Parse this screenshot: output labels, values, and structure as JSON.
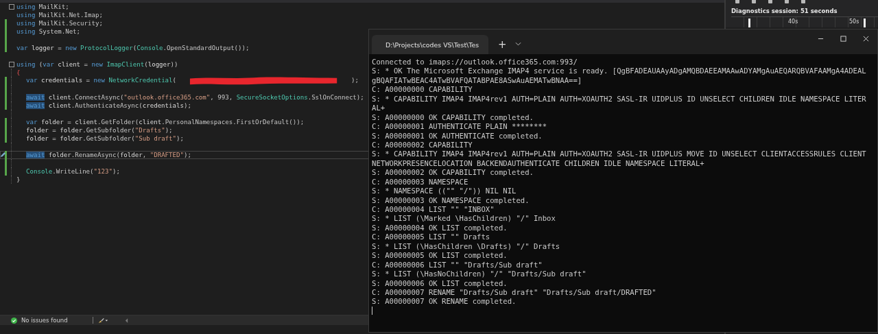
{
  "editor": {
    "lines": [
      {
        "kind": "code",
        "changed": false,
        "collapsible": true,
        "tokens": [
          {
            "kind": "kw",
            "s": "using"
          },
          {
            "kind": "plain",
            "s": " MailKit;"
          }
        ]
      },
      {
        "kind": "code",
        "changed": false,
        "tokens": [
          {
            "kind": "kw",
            "s": "using"
          },
          {
            "kind": "plain",
            "s": " MailKit.Net.Imap;"
          }
        ]
      },
      {
        "kind": "code",
        "changed": true,
        "tokens": [
          {
            "kind": "kw",
            "s": "using"
          },
          {
            "kind": "plain",
            "s": " MailKit.Security;"
          }
        ]
      },
      {
        "kind": "code",
        "changed": true,
        "tokens": [
          {
            "kind": "kw",
            "s": "using"
          },
          {
            "kind": "plain",
            "s": " System.Net;"
          }
        ]
      },
      {
        "kind": "blank",
        "changed": true
      },
      {
        "kind": "code",
        "changed": true,
        "tokens": [
          {
            "kind": "kw",
            "s": "var"
          },
          {
            "kind": "var",
            "s": " logger"
          },
          {
            "kind": "plain",
            "s": " = "
          },
          {
            "kind": "kw",
            "s": "new"
          },
          {
            "kind": "type",
            "s": " ProtocolLogger"
          },
          {
            "kind": "plain",
            "s": "("
          },
          {
            "kind": "type",
            "s": "Console"
          },
          {
            "kind": "plain",
            "s": ".OpenStandardOutput());"
          }
        ]
      },
      {
        "kind": "blank",
        "changed": false
      },
      {
        "kind": "code",
        "changed": false,
        "collapsible": true,
        "tokens": [
          {
            "kind": "kw",
            "s": "using"
          },
          {
            "kind": "plain",
            "s": " ("
          },
          {
            "kind": "kw",
            "s": "var"
          },
          {
            "kind": "var",
            "s": " client"
          },
          {
            "kind": "plain",
            "s": " = "
          },
          {
            "kind": "kw",
            "s": "new"
          },
          {
            "kind": "type",
            "s": " ImapClient"
          },
          {
            "kind": "plain",
            "s": "("
          },
          {
            "kind": "var",
            "s": "logger"
          },
          {
            "kind": "plain",
            "s": "))"
          }
        ],
        "children": [
          {
            "kind": "brace",
            "changed": false,
            "tokens": [
              {
                "kind": "brace",
                "s": "{"
              }
            ]
          },
          {
            "kind": "code",
            "changed": true,
            "tokens": [
              {
                "kind": "kw",
                "s": "var"
              },
              {
                "kind": "var",
                "s": " credentials"
              },
              {
                "kind": "plain",
                "s": " = "
              },
              {
                "kind": "kw",
                "s": "new"
              },
              {
                "kind": "type",
                "s": " NetworkCredential"
              },
              {
                "kind": "plain",
                "s": "("
              },
              {
                "kind": "redacted"
              },
              {
                "kind": "plain",
                "s": ");"
              }
            ]
          },
          {
            "kind": "blank",
            "changed": true
          },
          {
            "kind": "code",
            "changed": true,
            "tokens": [
              {
                "kind": "hl",
                "s": "await"
              },
              {
                "kind": "var",
                "s": " client"
              },
              {
                "kind": "plain",
                "s": ".ConnectAsync("
              },
              {
                "kind": "str",
                "s": "\"outlook.office365.com\""
              },
              {
                "kind": "plain",
                "s": ", 993, "
              },
              {
                "kind": "type",
                "s": "SecureSocketOptions"
              },
              {
                "kind": "plain",
                "s": ".SslOnConnect);"
              }
            ]
          },
          {
            "kind": "code",
            "changed": true,
            "tokens": [
              {
                "kind": "hl",
                "s": "await"
              },
              {
                "kind": "var",
                "s": " client"
              },
              {
                "kind": "plain",
                "s": ".AuthenticateAsync("
              },
              {
                "kind": "var",
                "s": "credentials"
              },
              {
                "kind": "plain",
                "s": ");"
              }
            ]
          },
          {
            "kind": "blank",
            "changed": false
          },
          {
            "kind": "code",
            "changed": true,
            "tokens": [
              {
                "kind": "kw",
                "s": "var"
              },
              {
                "kind": "var",
                "s": " folder"
              },
              {
                "kind": "plain",
                "s": " = "
              },
              {
                "kind": "var",
                "s": "client"
              },
              {
                "kind": "plain",
                "s": ".GetFolder("
              },
              {
                "kind": "var",
                "s": "client"
              },
              {
                "kind": "plain",
                "s": ".PersonalNamespaces.FirstOrDefault());"
              }
            ]
          },
          {
            "kind": "code",
            "changed": true,
            "tokens": [
              {
                "kind": "var",
                "s": "folder"
              },
              {
                "kind": "plain",
                "s": " = "
              },
              {
                "kind": "var",
                "s": "folder"
              },
              {
                "kind": "plain",
                "s": ".GetSubfolder("
              },
              {
                "kind": "str",
                "s": "\"Drafts\""
              },
              {
                "kind": "plain",
                "s": ");"
              }
            ]
          },
          {
            "kind": "code",
            "changed": true,
            "tokens": [
              {
                "kind": "var",
                "s": "folder"
              },
              {
                "kind": "plain",
                "s": " = "
              },
              {
                "kind": "var",
                "s": "folder"
              },
              {
                "kind": "plain",
                "s": ".GetSubfolder("
              },
              {
                "kind": "str",
                "s": "\"Sub draft\""
              },
              {
                "kind": "plain",
                "s": ");"
              }
            ]
          },
          {
            "kind": "blank",
            "changed": false
          },
          {
            "kind": "code",
            "changed": true,
            "current": true,
            "tokens": [
              {
                "kind": "hl",
                "s": "await"
              },
              {
                "kind": "var",
                "s": " folder"
              },
              {
                "kind": "plain",
                "s": ".RenameAsync("
              },
              {
                "kind": "var",
                "s": "folder"
              },
              {
                "kind": "plain",
                "s": ", "
              },
              {
                "kind": "str",
                "s": "\"DRAFTED\""
              },
              {
                "kind": "plain",
                "s": ");"
              }
            ]
          },
          {
            "kind": "blank",
            "changed": true
          },
          {
            "kind": "code",
            "changed": true,
            "tokens": [
              {
                "kind": "type",
                "s": "Console"
              },
              {
                "kind": "plain",
                "s": ".WriteLine("
              },
              {
                "kind": "str",
                "s": "\"123\""
              },
              {
                "kind": "plain",
                "s": ");"
              }
            ]
          },
          {
            "kind": "brace",
            "changed": false,
            "tokens": [
              {
                "kind": "plain",
                "s": "}"
              }
            ]
          }
        ]
      }
    ]
  },
  "status_bar": {
    "issues": "No issues found"
  },
  "diagnostics": {
    "title": "Diagnostics session: 51 seconds",
    "ticks": [
      "40s",
      "50s"
    ]
  },
  "terminal": {
    "tab_title": "D:\\Projects\\codes VS\\Test\\Tes",
    "new_tab": "+",
    "lines": [
      "Connected to imaps://outlook.office365.com:993/",
      "S: * OK The Microsoft Exchange IMAP4 service is ready. [QgBFADEAUAAyADgAMQBDAEEAMAAwADYAMgAuAEQARQBVAFAAMgA4ADEAL",
      "gBQAFIATwBEAC4ATwBVAFQATABPAE8ASwAuAEMATwBNAA==]",
      "C: A00000000 CAPABILITY",
      "S: * CAPABILITY IMAP4 IMAP4rev1 AUTH=PLAIN AUTH=XOAUTH2 SASL-IR UIDPLUS ID UNSELECT CHILDREN IDLE NAMESPACE LITER",
      "AL+",
      "S: A00000000 OK CAPABILITY completed.",
      "C: A00000001 AUTHENTICATE PLAIN ********",
      "S: A00000001 OK AUTHENTICATE completed.",
      "C: A00000002 CAPABILITY",
      "S: * CAPABILITY IMAP4 IMAP4rev1 AUTH=PLAIN AUTH=XOAUTH2 SASL-IR UIDPLUS MOVE ID UNSELECT CLIENTACCESSRULES CLIENT",
      "NETWORKPRESENCELOCATION BACKENDAUTHENTICATE CHILDREN IDLE NAMESPACE LITERAL+",
      "S: A00000002 OK CAPABILITY completed.",
      "C: A00000003 NAMESPACE",
      "S: * NAMESPACE ((\"\" \"/\")) NIL NIL",
      "S: A00000003 OK NAMESPACE completed.",
      "C: A00000004 LIST \"\" \"INBOX\"",
      "S: * LIST (\\Marked \\HasChildren) \"/\" Inbox",
      "S: A00000004 OK LIST completed.",
      "C: A00000005 LIST \"\" Drafts",
      "S: * LIST (\\HasChildren \\Drafts) \"/\" Drafts",
      "S: A00000005 OK LIST completed.",
      "C: A00000006 LIST \"\" \"Drafts/Sub draft\"",
      "S: * LIST (\\HasNoChildren) \"/\" \"Drafts/Sub draft\"",
      "S: A00000006 OK LIST completed.",
      "C: A00000007 RENAME \"Drafts/Sub draft\" \"Drafts/Sub draft/DRAFTED\"",
      "S: A00000007 OK RENAME completed."
    ]
  }
}
